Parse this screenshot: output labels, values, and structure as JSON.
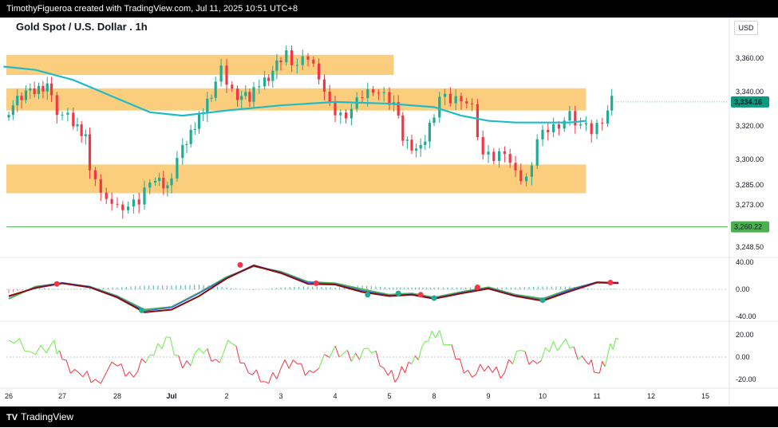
{
  "header": {
    "credit": "TimothyFigueroa created with TradingView.com, Jul 11, 2025 10:51 UTC+8"
  },
  "footer": {
    "logo_text": "TV",
    "brand": "TradingView"
  },
  "chart_title": "Gold Spot / U.S. Dollar . 1h",
  "currency": "USD",
  "colors": {
    "up": "#22ab94",
    "down": "#f23645",
    "ema": "#1fbcc8",
    "zone": "#fbc970",
    "hline": "#4caf50",
    "price_label": "#089981",
    "level_label": "#4caf50",
    "oscA": "#4caf50",
    "oscB": "#8b0a0a",
    "oscC": "#2962ff",
    "rsi_up": "#66ee44",
    "rsi_down": "#f23645"
  },
  "chart_data": [
    {
      "type": "candlestick",
      "title": "Gold Spot / U.S. Dollar . 1h",
      "x_ticks": [
        "26",
        "27",
        "28",
        "Jul",
        "2",
        "3",
        "4",
        "5",
        "8",
        "9",
        "10",
        "11",
        "12",
        "15"
      ],
      "y_ticks": [
        "3,360.00",
        "3,340.00",
        "3,320.00",
        "3,300.00",
        "3,285.00",
        "3,273.00",
        "3,248.50"
      ],
      "price_label": "3,334.16",
      "level_label": "3,260.22",
      "horizontal_line": 3260.22,
      "zones": [
        {
          "from_day": -0.2,
          "to_day": 7.1,
          "low": 3354,
          "high": 3358
        },
        {
          "from_day": -0.2,
          "to_day": 10.8,
          "low": 3333,
          "high": 3338
        },
        {
          "from_day": -0.2,
          "to_day": 10.8,
          "low": 3284,
          "high": 3293
        }
      ],
      "ema_path": [
        {
          "day": -0.1,
          "value": 3355
        },
        {
          "day": 0.5,
          "value": 3353
        },
        {
          "day": 1.2,
          "value": 3347
        },
        {
          "day": 2.0,
          "value": 3336
        },
        {
          "day": 2.6,
          "value": 3328
        },
        {
          "day": 3.2,
          "value": 3326
        },
        {
          "day": 4.0,
          "value": 3329
        },
        {
          "day": 5.0,
          "value": 3332
        },
        {
          "day": 6.0,
          "value": 3334
        },
        {
          "day": 7.0,
          "value": 3333
        },
        {
          "day": 8.0,
          "value": 3331
        },
        {
          "day": 8.5,
          "value": 3326
        },
        {
          "day": 9.0,
          "value": 3323
        },
        {
          "day": 9.5,
          "value": 3322
        },
        {
          "day": 10.5,
          "value": 3322
        },
        {
          "day": 10.8,
          "value": 3323
        }
      ],
      "closes": [
        {
          "day": 0.0,
          "value": 3328
        },
        {
          "day": 0.4,
          "value": 3338
        },
        {
          "day": 0.8,
          "value": 3344
        },
        {
          "day": 1.0,
          "value": 3330
        },
        {
          "day": 1.2,
          "value": 3325
        },
        {
          "day": 1.5,
          "value": 3315
        },
        {
          "day": 1.6,
          "value": 3290
        },
        {
          "day": 1.8,
          "value": 3283
        },
        {
          "day": 2.0,
          "value": 3270
        },
        {
          "day": 2.1,
          "value": 3275
        },
        {
          "day": 2.3,
          "value": 3272
        },
        {
          "day": 2.5,
          "value": 3275
        },
        {
          "day": 2.7,
          "value": 3290
        },
        {
          "day": 3.0,
          "value": 3283
        },
        {
          "day": 3.2,
          "value": 3300
        },
        {
          "day": 3.5,
          "value": 3320
        },
        {
          "day": 3.8,
          "value": 3340
        },
        {
          "day": 4.0,
          "value": 3352
        },
        {
          "day": 4.2,
          "value": 3340
        },
        {
          "day": 4.5,
          "value": 3335
        },
        {
          "day": 4.7,
          "value": 3345
        },
        {
          "day": 5.0,
          "value": 3355
        },
        {
          "day": 5.2,
          "value": 3362
        },
        {
          "day": 5.4,
          "value": 3355
        },
        {
          "day": 5.6,
          "value": 3360
        },
        {
          "day": 5.8,
          "value": 3350
        },
        {
          "day": 6.0,
          "value": 3330
        },
        {
          "day": 6.2,
          "value": 3326
        },
        {
          "day": 6.4,
          "value": 3330
        },
        {
          "day": 6.6,
          "value": 3338
        },
        {
          "day": 6.8,
          "value": 3343
        },
        {
          "day": 7.0,
          "value": 3337
        },
        {
          "day": 7.2,
          "value": 3333
        },
        {
          "day": 7.4,
          "value": 3312
        },
        {
          "day": 7.6,
          "value": 3308
        },
        {
          "day": 7.8,
          "value": 3305
        },
        {
          "day": 8.0,
          "value": 3320
        },
        {
          "day": 8.2,
          "value": 3337
        },
        {
          "day": 8.4,
          "value": 3335
        },
        {
          "day": 8.6,
          "value": 3338
        },
        {
          "day": 8.8,
          "value": 3330
        },
        {
          "day": 9.0,
          "value": 3302
        },
        {
          "day": 9.2,
          "value": 3300
        },
        {
          "day": 9.4,
          "value": 3306
        },
        {
          "day": 9.6,
          "value": 3290
        },
        {
          "day": 9.8,
          "value": 3288
        },
        {
          "day": 10.0,
          "value": 3312
        },
        {
          "day": 10.2,
          "value": 3318
        },
        {
          "day": 10.4,
          "value": 3322
        },
        {
          "day": 10.6,
          "value": 3326
        },
        {
          "day": 10.8,
          "value": 3320
        },
        {
          "day": 11.0,
          "value": 3316
        },
        {
          "day": 11.2,
          "value": 3324
        },
        {
          "day": 11.35,
          "value": 3334
        }
      ]
    },
    {
      "type": "line",
      "title": "",
      "y_ticks": [
        "40.00",
        "0.00",
        "-40.00"
      ],
      "ylim": [
        -45,
        45
      ],
      "series": [
        {
          "values": [
            [
              0,
              -14
            ],
            [
              0.5,
              4
            ],
            [
              1.0,
              9
            ],
            [
              1.5,
              4
            ],
            [
              2.0,
              -10
            ],
            [
              2.5,
              -30
            ],
            [
              3.0,
              -26
            ],
            [
              3.5,
              -5
            ],
            [
              4.0,
              18
            ],
            [
              4.5,
              34
            ],
            [
              5.0,
              26
            ],
            [
              5.5,
              11
            ],
            [
              6.0,
              9
            ],
            [
              6.5,
              0
            ],
            [
              7.0,
              -8
            ],
            [
              7.5,
              -6
            ],
            [
              8.0,
              -12
            ],
            [
              8.5,
              -4
            ],
            [
              9.0,
              3
            ],
            [
              9.5,
              -8
            ],
            [
              10.0,
              -14
            ],
            [
              10.5,
              0
            ],
            [
              11.0,
              10
            ],
            [
              11.4,
              10
            ]
          ]
        },
        {
          "values": [
            [
              0,
              -10
            ],
            [
              0.5,
              2
            ],
            [
              1.0,
              9
            ],
            [
              1.5,
              3
            ],
            [
              2.0,
              -12
            ],
            [
              2.5,
              -34
            ],
            [
              3.0,
              -30
            ],
            [
              3.5,
              -10
            ],
            [
              4.0,
              16
            ],
            [
              4.5,
              35
            ],
            [
              5.0,
              24
            ],
            [
              5.5,
              8
            ],
            [
              6.0,
              7
            ],
            [
              6.5,
              -4
            ],
            [
              7.0,
              -10
            ],
            [
              7.5,
              -8
            ],
            [
              8.0,
              -14
            ],
            [
              8.5,
              -6
            ],
            [
              9.0,
              1
            ],
            [
              9.5,
              -10
            ],
            [
              10.0,
              -17
            ],
            [
              10.5,
              -3
            ],
            [
              11.0,
              10
            ],
            [
              11.4,
              9
            ]
          ]
        },
        {
          "values": [
            [
              0,
              -11
            ],
            [
              0.5,
              3
            ],
            [
              1.0,
              10
            ],
            [
              1.5,
              4
            ],
            [
              2.0,
              -11
            ],
            [
              2.5,
              -32
            ],
            [
              3.0,
              -27
            ],
            [
              3.5,
              -6
            ],
            [
              4.0,
              17
            ],
            [
              4.5,
              36
            ],
            [
              5.0,
              25
            ],
            [
              5.5,
              10
            ],
            [
              6.0,
              8
            ],
            [
              6.5,
              -2
            ],
            [
              7.0,
              -9
            ],
            [
              7.5,
              -7
            ],
            [
              8.0,
              -13
            ],
            [
              8.5,
              -5
            ],
            [
              9.0,
              2
            ],
            [
              9.5,
              -9
            ],
            [
              10.0,
              -16
            ],
            [
              10.5,
              -1
            ],
            [
              11.0,
              11
            ],
            [
              11.4,
              10
            ]
          ]
        }
      ]
    },
    {
      "type": "line",
      "title": "",
      "y_ticks": [
        "20.00",
        "0.00",
        "-20.00"
      ],
      "ylim": [
        -30,
        30
      ],
      "series": [
        {
          "values": [
            [
              0,
              15
            ],
            [
              0.4,
              5
            ],
            [
              0.8,
              12
            ],
            [
              1.0,
              -2
            ],
            [
              1.3,
              -14
            ],
            [
              1.6,
              -20
            ],
            [
              2.0,
              -8
            ],
            [
              2.3,
              -18
            ],
            [
              2.6,
              2
            ],
            [
              2.9,
              18
            ],
            [
              3.2,
              -10
            ],
            [
              3.5,
              8
            ],
            [
              3.8,
              -2
            ],
            [
              4.1,
              12
            ],
            [
              4.4,
              -14
            ],
            [
              4.7,
              -22
            ],
            [
              5.0,
              -10
            ],
            [
              5.3,
              -6
            ],
            [
              5.6,
              -14
            ],
            [
              6.0,
              10
            ],
            [
              6.3,
              -4
            ],
            [
              6.6,
              8
            ],
            [
              6.9,
              -10
            ],
            [
              7.2,
              -18
            ],
            [
              7.5,
              -6
            ],
            [
              7.8,
              14
            ],
            [
              8.1,
              24
            ],
            [
              8.4,
              -2
            ],
            [
              8.7,
              -18
            ],
            [
              9.0,
              -8
            ],
            [
              9.3,
              -14
            ],
            [
              9.6,
              6
            ],
            [
              9.9,
              -6
            ],
            [
              10.2,
              14
            ],
            [
              10.5,
              8
            ],
            [
              10.8,
              -4
            ],
            [
              11.0,
              -14
            ],
            [
              11.2,
              2
            ],
            [
              11.4,
              16
            ]
          ]
        }
      ]
    }
  ]
}
